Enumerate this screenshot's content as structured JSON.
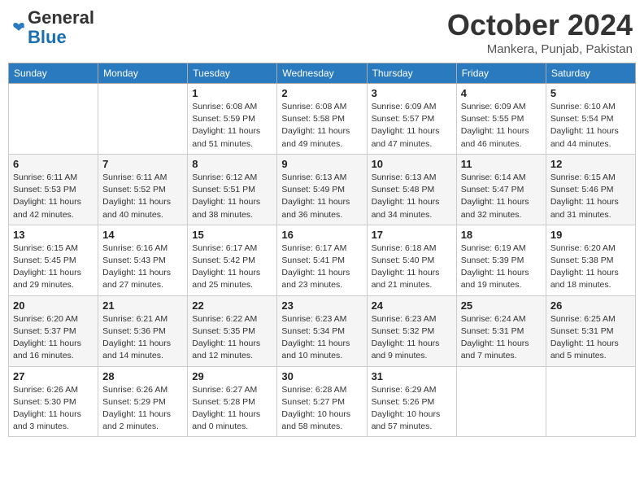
{
  "header": {
    "logo_general": "General",
    "logo_blue": "Blue",
    "month_title": "October 2024",
    "subtitle": "Mankera, Punjab, Pakistan"
  },
  "days_of_week": [
    "Sunday",
    "Monday",
    "Tuesday",
    "Wednesday",
    "Thursday",
    "Friday",
    "Saturday"
  ],
  "weeks": [
    [
      {
        "day": "",
        "info": ""
      },
      {
        "day": "",
        "info": ""
      },
      {
        "day": "1",
        "info": "Sunrise: 6:08 AM\nSunset: 5:59 PM\nDaylight: 11 hours and 51 minutes."
      },
      {
        "day": "2",
        "info": "Sunrise: 6:08 AM\nSunset: 5:58 PM\nDaylight: 11 hours and 49 minutes."
      },
      {
        "day": "3",
        "info": "Sunrise: 6:09 AM\nSunset: 5:57 PM\nDaylight: 11 hours and 47 minutes."
      },
      {
        "day": "4",
        "info": "Sunrise: 6:09 AM\nSunset: 5:55 PM\nDaylight: 11 hours and 46 minutes."
      },
      {
        "day": "5",
        "info": "Sunrise: 6:10 AM\nSunset: 5:54 PM\nDaylight: 11 hours and 44 minutes."
      }
    ],
    [
      {
        "day": "6",
        "info": "Sunrise: 6:11 AM\nSunset: 5:53 PM\nDaylight: 11 hours and 42 minutes."
      },
      {
        "day": "7",
        "info": "Sunrise: 6:11 AM\nSunset: 5:52 PM\nDaylight: 11 hours and 40 minutes."
      },
      {
        "day": "8",
        "info": "Sunrise: 6:12 AM\nSunset: 5:51 PM\nDaylight: 11 hours and 38 minutes."
      },
      {
        "day": "9",
        "info": "Sunrise: 6:13 AM\nSunset: 5:49 PM\nDaylight: 11 hours and 36 minutes."
      },
      {
        "day": "10",
        "info": "Sunrise: 6:13 AM\nSunset: 5:48 PM\nDaylight: 11 hours and 34 minutes."
      },
      {
        "day": "11",
        "info": "Sunrise: 6:14 AM\nSunset: 5:47 PM\nDaylight: 11 hours and 32 minutes."
      },
      {
        "day": "12",
        "info": "Sunrise: 6:15 AM\nSunset: 5:46 PM\nDaylight: 11 hours and 31 minutes."
      }
    ],
    [
      {
        "day": "13",
        "info": "Sunrise: 6:15 AM\nSunset: 5:45 PM\nDaylight: 11 hours and 29 minutes."
      },
      {
        "day": "14",
        "info": "Sunrise: 6:16 AM\nSunset: 5:43 PM\nDaylight: 11 hours and 27 minutes."
      },
      {
        "day": "15",
        "info": "Sunrise: 6:17 AM\nSunset: 5:42 PM\nDaylight: 11 hours and 25 minutes."
      },
      {
        "day": "16",
        "info": "Sunrise: 6:17 AM\nSunset: 5:41 PM\nDaylight: 11 hours and 23 minutes."
      },
      {
        "day": "17",
        "info": "Sunrise: 6:18 AM\nSunset: 5:40 PM\nDaylight: 11 hours and 21 minutes."
      },
      {
        "day": "18",
        "info": "Sunrise: 6:19 AM\nSunset: 5:39 PM\nDaylight: 11 hours and 19 minutes."
      },
      {
        "day": "19",
        "info": "Sunrise: 6:20 AM\nSunset: 5:38 PM\nDaylight: 11 hours and 18 minutes."
      }
    ],
    [
      {
        "day": "20",
        "info": "Sunrise: 6:20 AM\nSunset: 5:37 PM\nDaylight: 11 hours and 16 minutes."
      },
      {
        "day": "21",
        "info": "Sunrise: 6:21 AM\nSunset: 5:36 PM\nDaylight: 11 hours and 14 minutes."
      },
      {
        "day": "22",
        "info": "Sunrise: 6:22 AM\nSunset: 5:35 PM\nDaylight: 11 hours and 12 minutes."
      },
      {
        "day": "23",
        "info": "Sunrise: 6:23 AM\nSunset: 5:34 PM\nDaylight: 11 hours and 10 minutes."
      },
      {
        "day": "24",
        "info": "Sunrise: 6:23 AM\nSunset: 5:32 PM\nDaylight: 11 hours and 9 minutes."
      },
      {
        "day": "25",
        "info": "Sunrise: 6:24 AM\nSunset: 5:31 PM\nDaylight: 11 hours and 7 minutes."
      },
      {
        "day": "26",
        "info": "Sunrise: 6:25 AM\nSunset: 5:31 PM\nDaylight: 11 hours and 5 minutes."
      }
    ],
    [
      {
        "day": "27",
        "info": "Sunrise: 6:26 AM\nSunset: 5:30 PM\nDaylight: 11 hours and 3 minutes."
      },
      {
        "day": "28",
        "info": "Sunrise: 6:26 AM\nSunset: 5:29 PM\nDaylight: 11 hours and 2 minutes."
      },
      {
        "day": "29",
        "info": "Sunrise: 6:27 AM\nSunset: 5:28 PM\nDaylight: 11 hours and 0 minutes."
      },
      {
        "day": "30",
        "info": "Sunrise: 6:28 AM\nSunset: 5:27 PM\nDaylight: 10 hours and 58 minutes."
      },
      {
        "day": "31",
        "info": "Sunrise: 6:29 AM\nSunset: 5:26 PM\nDaylight: 10 hours and 57 minutes."
      },
      {
        "day": "",
        "info": ""
      },
      {
        "day": "",
        "info": ""
      }
    ]
  ]
}
